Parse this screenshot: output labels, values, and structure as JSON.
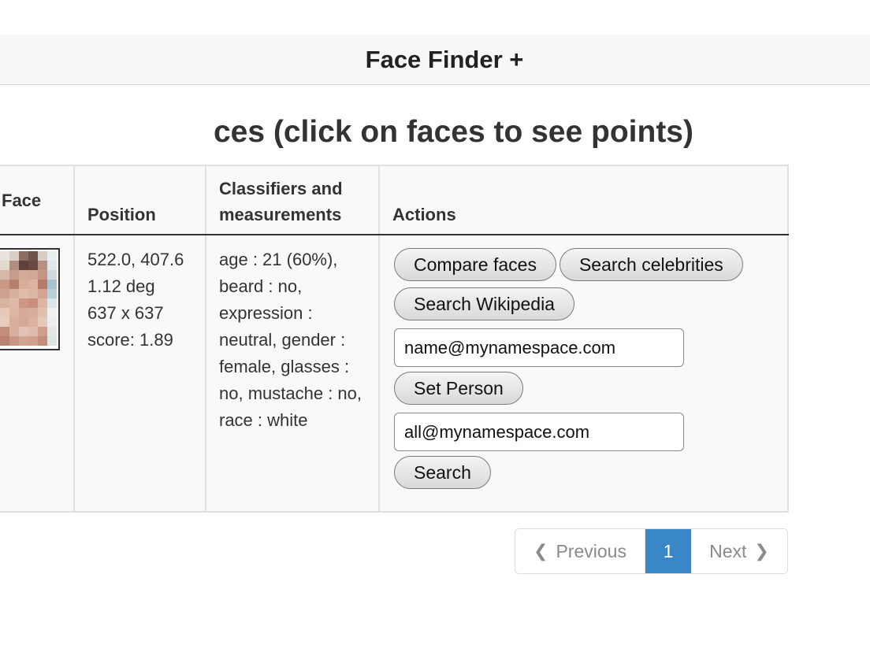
{
  "navbar": {
    "title": "Face Finder +"
  },
  "page": {
    "heading": "ces (click on faces to see points)"
  },
  "table": {
    "headers": {
      "face": "Face",
      "position": "Position",
      "classifiers": "Classifiers and measurements",
      "actions": "Actions"
    },
    "row": {
      "position_lines": [
        "522.0, 407.6",
        "1.12 deg",
        "637 x 637",
        "score: 1.89"
      ],
      "classifiers_text": "age : 21 (60%), beard : no, expression : neutral, gender : female, glasses : no, mustache : no, race : white",
      "actions": {
        "compare_faces": "Compare faces",
        "search_celebrities": "Search celebrities",
        "search_wikipedia": "Search Wikipedia",
        "person_input_value": "name@mynamespace.com",
        "set_person": "Set Person",
        "search_input_value": "all@mynamespace.com",
        "search": "Search"
      }
    }
  },
  "pagination": {
    "previous": "Previous",
    "current_page": "1",
    "next": "Next"
  },
  "colors": {
    "active_page": "#3a87c8",
    "navbar_bg": "#f8f8f8",
    "table_bg": "#f9f9f9"
  }
}
